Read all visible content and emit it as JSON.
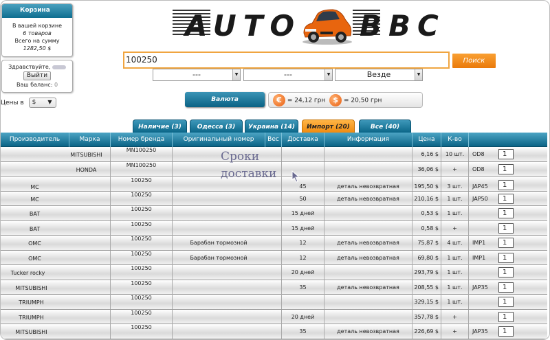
{
  "cart": {
    "title": "Корзина",
    "line1": "В вашей корзине",
    "line2": "6 товаров",
    "line3": "Всего на сумму",
    "line4": "1282,50 $"
  },
  "account": {
    "greeting": "Здравствуйте,",
    "exit_label": "Выйти",
    "balance_label": "Ваш баланс:",
    "balance_value": "0"
  },
  "prices": {
    "label": "Цены в",
    "currency": "$"
  },
  "logo": {
    "left": "AUTO",
    "right": "BBC",
    "car_color": "#e8650e"
  },
  "search": {
    "value": "100250",
    "button": "Поиск"
  },
  "filters": {
    "dd1": "---",
    "dd2": "---",
    "dd3": "Везде"
  },
  "currency": {
    "button": "Валюта",
    "eur_symbol": "€",
    "eur_rate": "= 24,12 грн",
    "usd_symbol": "$",
    "usd_rate": "= 20,50 грн"
  },
  "tabs": [
    {
      "label": "Наличие (3)",
      "active": false
    },
    {
      "label": "Одесса (3)",
      "active": false
    },
    {
      "label": "Украина (14)",
      "active": false
    },
    {
      "label": "Импорт (20)",
      "active": true
    },
    {
      "label": "Все (40)",
      "active": false
    }
  ],
  "columns": [
    "Производитель",
    "Марка",
    "Номер бренда",
    "Оригинальный номер",
    "Вес",
    "Доставка",
    "Информация",
    "Цена",
    "К-во"
  ],
  "rows": [
    {
      "maker": "",
      "brand": "MITSUBISHI",
      "number": "MN100250",
      "orig": "",
      "delivery": "",
      "info": "",
      "price": "6,16 $",
      "stock": "10 шт.",
      "code": "OD8",
      "qty": "1"
    },
    {
      "maker": "",
      "brand": "HONDA",
      "number": "MN100250",
      "orig": "",
      "delivery": "",
      "info": "",
      "price": "36,06 $",
      "stock": "+",
      "code": "OD8",
      "qty": "1"
    },
    {
      "maker": "MC",
      "brand": "",
      "number": "100250",
      "orig": "",
      "delivery": "45",
      "info": "деталь невозвратная",
      "price": "195,50 $",
      "stock": "3 шт.",
      "code": "JAP45",
      "qty": "1"
    },
    {
      "maker": "MC",
      "brand": "",
      "number": "100250",
      "orig": "",
      "delivery": "50",
      "info": "деталь невозвратная",
      "price": "210,16 $",
      "stock": "1 шт.",
      "code": "JAP50",
      "qty": "1"
    },
    {
      "maker": "BAT",
      "brand": "",
      "number": "100250",
      "orig": "",
      "delivery": "15 дней",
      "info": "",
      "price": "0,53 $",
      "stock": "1 шт.",
      "code": "",
      "qty": "1"
    },
    {
      "maker": "BAT",
      "brand": "",
      "number": "100250",
      "orig": "",
      "delivery": "15 дней",
      "info": "",
      "price": "0,58 $",
      "stock": "+",
      "code": "",
      "qty": "1"
    },
    {
      "maker": "OMC",
      "brand": "",
      "number": "100250",
      "orig": "Барабан тормозной",
      "delivery": "12",
      "info": "деталь невозвратная",
      "price": "75,87 $",
      "stock": "4 шт.",
      "code": "IMP1",
      "qty": "1"
    },
    {
      "maker": "OMC",
      "brand": "",
      "number": "100250",
      "orig": "Барабан тормозной",
      "delivery": "12",
      "info": "деталь невозвратная",
      "price": "69,80 $",
      "stock": "1 шт.",
      "code": "IMP1",
      "qty": "1"
    },
    {
      "maker": "Tucker rocky",
      "brand": "",
      "number": "100250",
      "orig": "",
      "delivery": "20 дней",
      "info": "",
      "price": "293,79 $",
      "stock": "1 шт.",
      "code": "",
      "qty": "1"
    },
    {
      "maker": "MITSUBISHI",
      "brand": "",
      "number": "100250",
      "orig": "",
      "delivery": "35",
      "info": "деталь невозвратная",
      "price": "208,55 $",
      "stock": "1 шт.",
      "code": "JAP35",
      "qty": "1"
    },
    {
      "maker": "TRIUMPH",
      "brand": "",
      "number": "100250",
      "orig": "",
      "delivery": "",
      "info": "",
      "price": "329,15 $",
      "stock": "1 шт.",
      "code": "",
      "qty": "1"
    },
    {
      "maker": "TRIUMPH",
      "brand": "",
      "number": "100250",
      "orig": "",
      "delivery": "20 дней",
      "info": "",
      "price": "357,78 $",
      "stock": "+",
      "code": "",
      "qty": "1"
    },
    {
      "maker": "MITSUBISHI",
      "brand": "",
      "number": "100250",
      "orig": "",
      "delivery": "35",
      "info": "деталь невозвратная",
      "price": "226,69 $",
      "stock": "+",
      "code": "JAP35",
      "qty": "1"
    }
  ],
  "tooltip": {
    "line1": "Сроки",
    "line2": "доставки"
  }
}
